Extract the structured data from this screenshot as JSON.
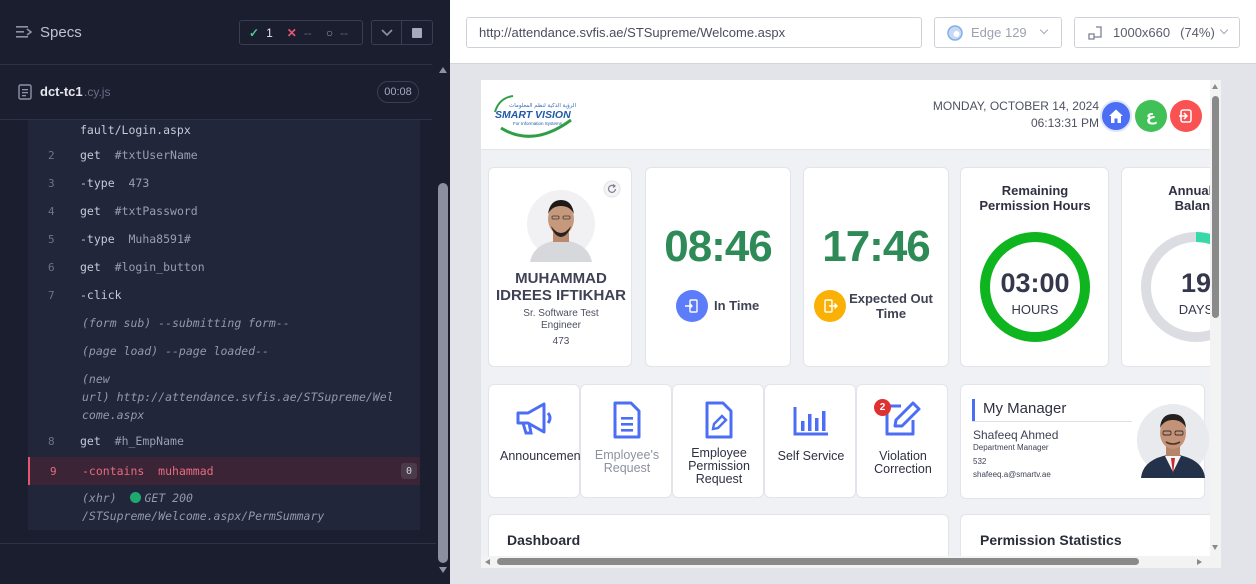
{
  "runner": {
    "specs_label": "Specs",
    "stats": {
      "passed": "1",
      "failed": "--",
      "pending": "--"
    },
    "spec": {
      "name": "dct-tc1",
      "ext": ".cy.js",
      "duration": "00:08"
    },
    "commands": [
      {
        "type": "cont",
        "text": "fault/Login.aspx"
      },
      {
        "type": "cmd",
        "num": "2",
        "name": "get",
        "arg": "#txtUserName"
      },
      {
        "type": "cmd",
        "num": "3",
        "name": "-type",
        "arg": "473"
      },
      {
        "type": "cmd",
        "num": "4",
        "name": "get",
        "arg": "#txtPassword"
      },
      {
        "type": "cmd",
        "num": "5",
        "name": "-type",
        "arg": "Muha8591#"
      },
      {
        "type": "cmd",
        "num": "6",
        "name": "get",
        "arg": "#login_button"
      },
      {
        "type": "cmd",
        "num": "7",
        "name": "-click",
        "arg": ""
      },
      {
        "type": "event",
        "text": "(form sub)  --submitting form--"
      },
      {
        "type": "event",
        "text": "(page load)  --page loaded--"
      },
      {
        "type": "event",
        "text": "(new"
      },
      {
        "type": "event",
        "text": "url)  http://attendance.svfis.ae/STSupreme/Wel"
      },
      {
        "type": "event",
        "text": "come.aspx"
      },
      {
        "type": "cmd",
        "num": "8",
        "name": "get",
        "arg": "#h_EmpName"
      },
      {
        "type": "err",
        "num": "9",
        "name": "-contains",
        "arg": "muhammad",
        "badge": "0"
      },
      {
        "type": "xhr",
        "text": "(xhr)",
        "status": "GET 200"
      },
      {
        "type": "event",
        "text": "/STSupreme/Welcome.aspx/PermSummary"
      }
    ]
  },
  "browser": {
    "url": "http://attendance.svfis.ae/STSupreme/Welcome.aspx",
    "browser_name": "Edge 129",
    "viewport": "1000x660",
    "zoom": "(74%)"
  },
  "app": {
    "logo_text": "SMART VISION",
    "logo_sub": "For Information Systems",
    "logo_arabic": "الرؤية الذكية لنظم المعلومات",
    "date": "MONDAY, OCTOBER 14, 2024",
    "time": "06:13:31 PM",
    "lang_btn": "ع",
    "employee": {
      "name_line1": "MUHAMMAD",
      "name_line2": "IDREES IFTIKHAR",
      "title_line1": "Sr. Software Test",
      "title_line2": "Engineer",
      "id": "473"
    },
    "in_time": {
      "value": "08:46",
      "label": "In Time"
    },
    "out_time": {
      "value": "17:46",
      "label_line1": "Expected Out",
      "label_line2": "Time"
    },
    "permission": {
      "title_line1": "Remaining",
      "title_line2": "Permission Hours",
      "value": "03:00",
      "unit": "HOURS",
      "fraction": 1.0
    },
    "leave": {
      "title_line1": "Annual L",
      "title_line2": "Balanc",
      "value": "19",
      "unit": "DAYS",
      "fraction": 0.42
    },
    "tiles": [
      {
        "label_lines": [
          "Announcemen"
        ],
        "icon": "megaphone-icon",
        "muted": false
      },
      {
        "label_lines": [
          "Employee's",
          "Request"
        ],
        "icon": "document-icon",
        "muted": true
      },
      {
        "label_lines": [
          "Employee",
          "Permission",
          "Request"
        ],
        "icon": "edit-document-icon",
        "muted": false
      },
      {
        "label_lines": [
          "Self Service"
        ],
        "icon": "bar-chart-icon",
        "muted": false
      },
      {
        "label_lines": [
          "Violation",
          "Correction"
        ],
        "icon": "pencil-square-icon",
        "muted": false,
        "badge": "2"
      }
    ],
    "manager": {
      "heading": "My Manager",
      "name": "Shafeeq Ahmed",
      "title": "Department Manager",
      "id": "532",
      "email": "shafeeq.a@smartv.ae"
    },
    "dashboard_title": "Dashboard",
    "perm_stats_title": "Permission Statistics"
  }
}
